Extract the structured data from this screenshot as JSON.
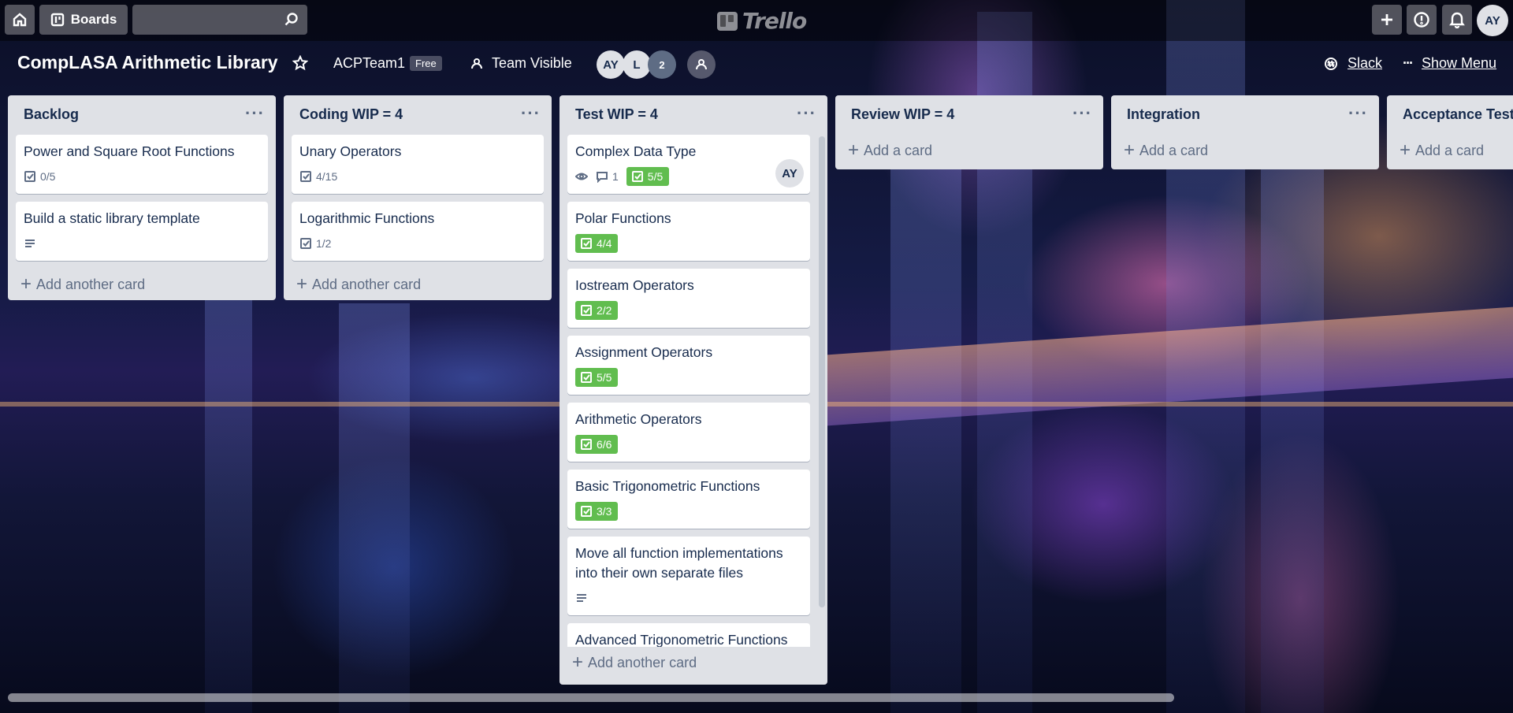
{
  "header": {
    "boards_label": "Boards",
    "search_placeholder": "",
    "logo_text": "Trello",
    "user_initials": "AY"
  },
  "board": {
    "title": "CompLASA Arithmetic Library",
    "team": "ACPTeam1",
    "plan_badge": "Free",
    "visibility": "Team Visible",
    "members": [
      "AY",
      "L"
    ],
    "members_more": "2",
    "slack_label": "Slack",
    "menu_dots": "···",
    "show_menu_label": "Show Menu"
  },
  "lists": [
    {
      "title": "Backlog",
      "cards": [
        {
          "title": "Power and Square Root Functions",
          "checklist": "0/5"
        },
        {
          "title": "Build a static library template",
          "has_description": true
        }
      ],
      "add_label": "Add another card"
    },
    {
      "title": "Coding WIP = 4",
      "cards": [
        {
          "title": "Unary Operators",
          "checklist": "4/15"
        },
        {
          "title": "Logarithmic Functions",
          "checklist": "1/2"
        }
      ],
      "add_label": "Add another card"
    },
    {
      "title": "Test WIP = 4",
      "cards": [
        {
          "title": "Complex Data Type",
          "watching": true,
          "comments": "1",
          "checklist": "5/5",
          "checklist_complete": true,
          "member": "AY"
        },
        {
          "title": "Polar Functions",
          "checklist": "4/4",
          "checklist_complete": true
        },
        {
          "title": "Iostream Operators",
          "checklist": "2/2",
          "checklist_complete": true
        },
        {
          "title": "Assignment Operators",
          "checklist": "5/5",
          "checklist_complete": true
        },
        {
          "title": "Arithmetic Operators",
          "checklist": "6/6",
          "checklist_complete": true
        },
        {
          "title": "Basic Trigonometric Functions",
          "checklist": "3/3",
          "checklist_complete": true
        },
        {
          "title": "Move all function implementations into their own separate files",
          "has_description": true
        },
        {
          "title": "Advanced Trigonometric Functions"
        }
      ],
      "add_label": "Add another card"
    },
    {
      "title": "Review WIP = 4",
      "cards": [],
      "add_label": "Add a card"
    },
    {
      "title": "Integration",
      "cards": [],
      "add_label": "Add a card"
    },
    {
      "title": "Acceptance Test",
      "cards": [],
      "add_label": "Add a card"
    }
  ],
  "icons": {
    "home": "home-icon",
    "boards": "boards-icon",
    "search": "search-icon",
    "add": "plus-icon",
    "info": "info-icon",
    "notifications": "bell-icon",
    "star": "star-icon",
    "visibility": "team-icon",
    "invite": "add-member-icon",
    "slack": "slack-icon",
    "more": "more-icon",
    "checklist": "checkbox-icon",
    "watch": "eye-icon",
    "comment": "comment-icon",
    "description": "description-icon"
  },
  "colors": {
    "complete_badge": "#61bd4f",
    "list_bg": "#dfe1e6",
    "text": "#172b4d"
  }
}
